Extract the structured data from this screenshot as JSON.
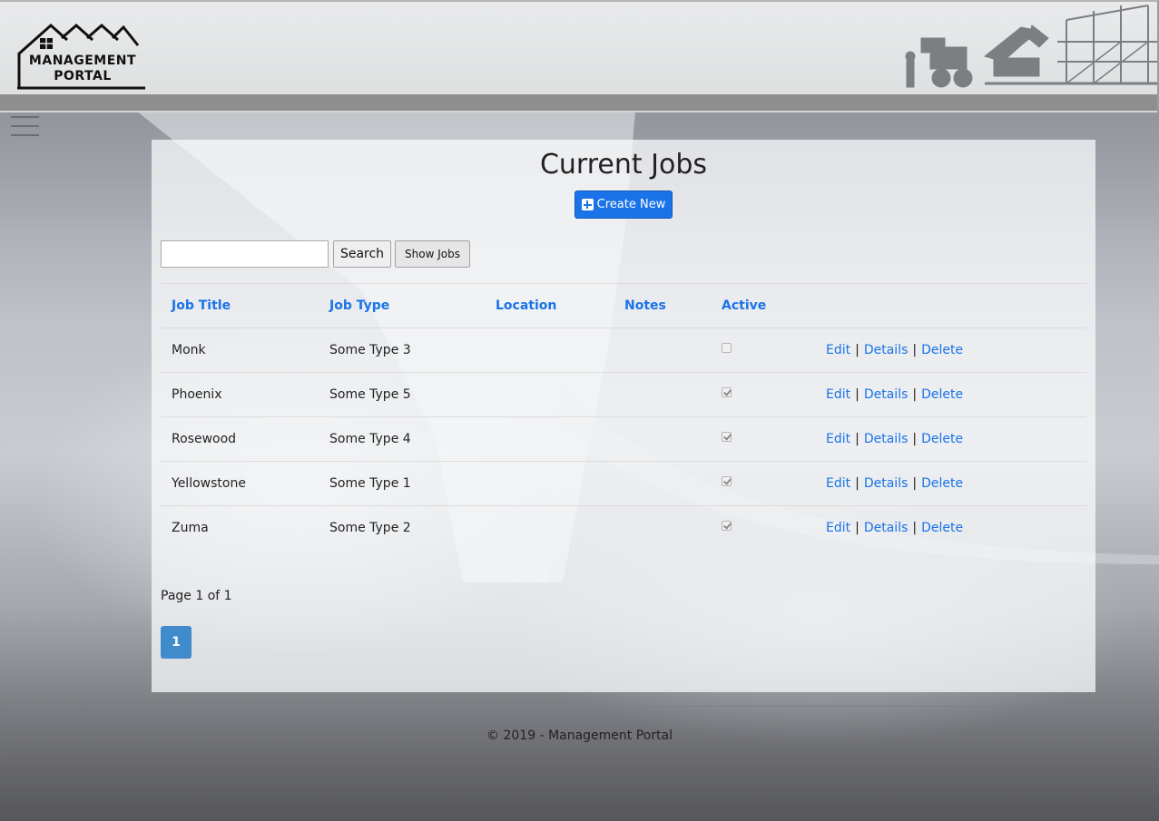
{
  "header": {
    "logo_line1": "MANAGEMENT",
    "logo_line2": "PORTAL"
  },
  "main": {
    "title": "Current Jobs",
    "create_label": "Create New",
    "search_value": "",
    "search_label": "Search",
    "show_jobs_label": "Show Jobs",
    "columns": [
      "Job Title",
      "Job Type",
      "Location",
      "Notes",
      "Active",
      ""
    ],
    "rows": [
      {
        "title": "Monk",
        "type": "Some Type 3",
        "location": "",
        "notes": "",
        "active": false
      },
      {
        "title": "Phoenix",
        "type": "Some Type 5",
        "location": "",
        "notes": "",
        "active": true
      },
      {
        "title": "Rosewood",
        "type": "Some Type 4",
        "location": "",
        "notes": "",
        "active": true
      },
      {
        "title": "Yellowstone",
        "type": "Some Type 1",
        "location": "",
        "notes": "",
        "active": true
      },
      {
        "title": "Zuma",
        "type": "Some Type 2",
        "location": "",
        "notes": "",
        "active": true
      }
    ],
    "actions": {
      "edit": "Edit",
      "details": "Details",
      "delete": "Delete",
      "separator": "|"
    },
    "page_info": "Page 1 of 1",
    "current_page": "1"
  },
  "footer": {
    "text": "© 2019 - Management Portal"
  },
  "colors": {
    "accent": "#1a73e8",
    "pager": "#3f8bcc"
  }
}
